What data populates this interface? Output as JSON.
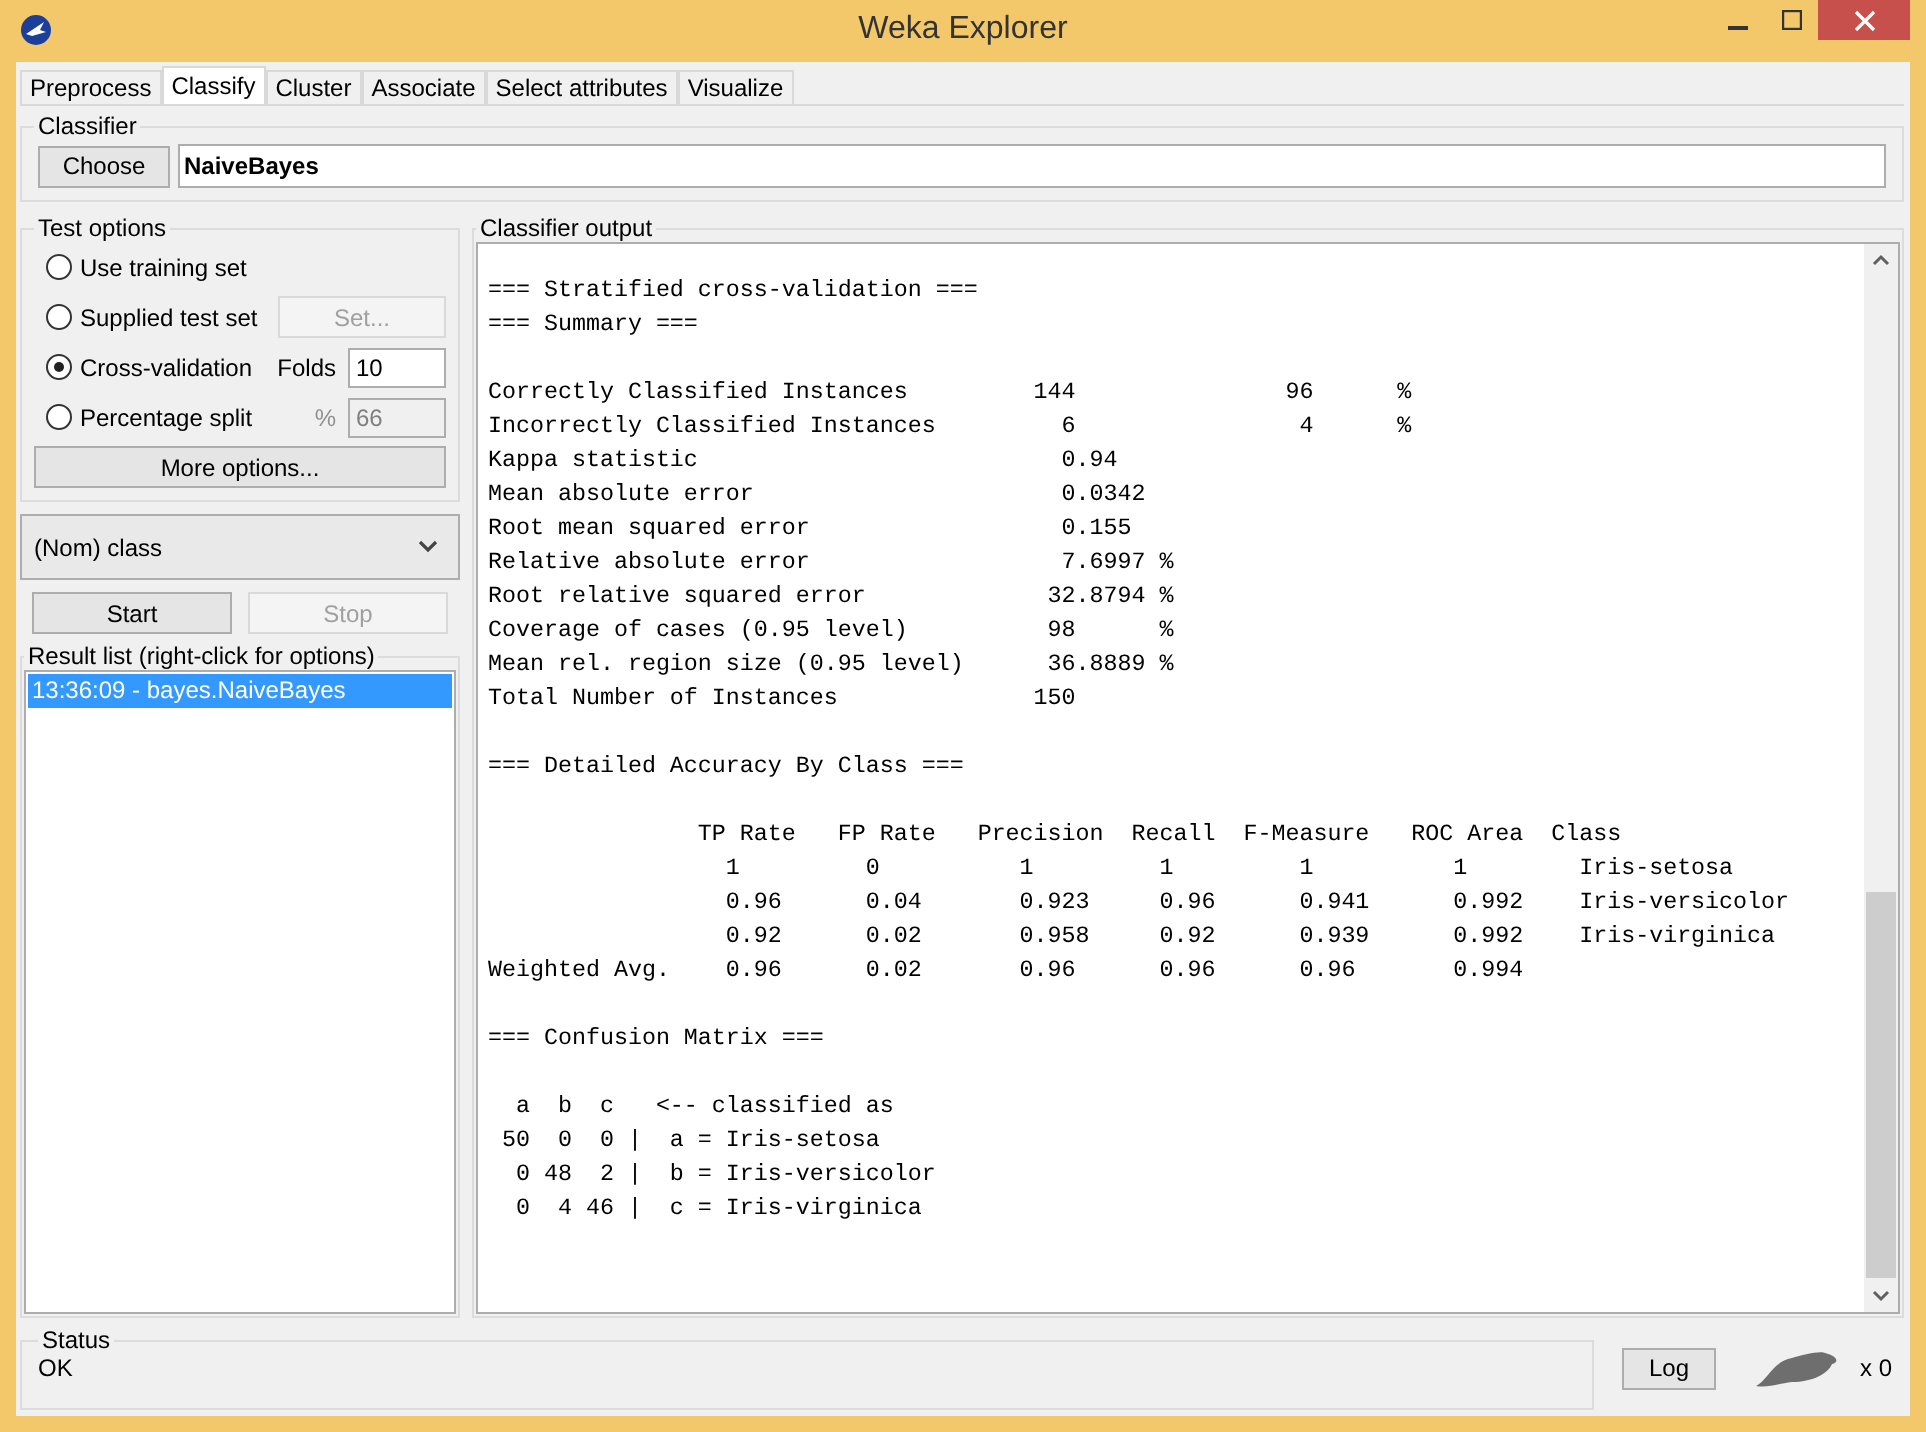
{
  "window": {
    "title": "Weka Explorer"
  },
  "tabs": [
    {
      "label": "Preprocess",
      "selected": false
    },
    {
      "label": "Classify",
      "selected": true
    },
    {
      "label": "Cluster",
      "selected": false
    },
    {
      "label": "Associate",
      "selected": false
    },
    {
      "label": "Select attributes",
      "selected": false
    },
    {
      "label": "Visualize",
      "selected": false
    }
  ],
  "classifier": {
    "group_label": "Classifier",
    "choose_button": "Choose",
    "name": "NaiveBayes"
  },
  "test_options": {
    "group_label": "Test options",
    "options": [
      {
        "label": "Use training set",
        "selected": false,
        "kind": "plain"
      },
      {
        "label": "Supplied test set",
        "selected": false,
        "kind": "button",
        "button": {
          "label": "Set...",
          "disabled": true
        }
      },
      {
        "label": "Cross-validation",
        "selected": true,
        "kind": "field",
        "field": {
          "label": "Folds",
          "value": "10",
          "disabled": false
        }
      },
      {
        "label": "Percentage split",
        "selected": false,
        "kind": "field",
        "field": {
          "label": "%",
          "value": "66",
          "disabled": true
        }
      }
    ],
    "more_button": "More options..."
  },
  "class_select": {
    "value": "(Nom) class"
  },
  "run_buttons": [
    {
      "label": "Start",
      "disabled": false
    },
    {
      "label": "Stop",
      "disabled": true
    }
  ],
  "result_list": {
    "group_label": "Result list (right-click for options)",
    "items": [
      {
        "label": "13:36:09 - bayes.NaiveBayes",
        "selected": true
      }
    ]
  },
  "output": {
    "group_label": "Classifier output",
    "sections": [
      {
        "lines": [
          "=== Stratified cross-validation ===",
          "=== Summary ==="
        ]
      },
      {
        "lines": [
          "Correctly Classified Instances         144               96      %",
          "Incorrectly Classified Instances         6                4      %",
          "Kappa statistic                          0.94",
          "Mean absolute error                      0.0342",
          "Root mean squared error                  0.155",
          "Relative absolute error                  7.6997 %",
          "Root relative squared error             32.8794 %",
          "Coverage of cases (0.95 level)          98      %",
          "Mean rel. region size (0.95 level)      36.8889 %",
          "Total Number of Instances              150"
        ]
      },
      {
        "lines": [
          "=== Detailed Accuracy By Class ==="
        ]
      },
      {
        "lines": [
          "               TP Rate   FP Rate   Precision  Recall  F-Measure   ROC Area  Class",
          "                 1         0          1         1         1          1        Iris-setosa",
          "                 0.96      0.04       0.923     0.96      0.941      0.992    Iris-versicolor",
          "                 0.92      0.02       0.958     0.92      0.939      0.992    Iris-virginica",
          "Weighted Avg.    0.96      0.02       0.96      0.96      0.96       0.994"
        ]
      },
      {
        "lines": [
          "=== Confusion Matrix ==="
        ]
      },
      {
        "lines": [
          "  a  b  c   <-- classified as",
          " 50  0  0 |  a = Iris-setosa",
          "  0 48  2 |  b = Iris-versicolor",
          "  0  4 46 |  c = Iris-virginica"
        ]
      }
    ]
  },
  "status": {
    "group_label": "Status",
    "message": "OK",
    "log_button": "Log",
    "count": "x 0"
  }
}
